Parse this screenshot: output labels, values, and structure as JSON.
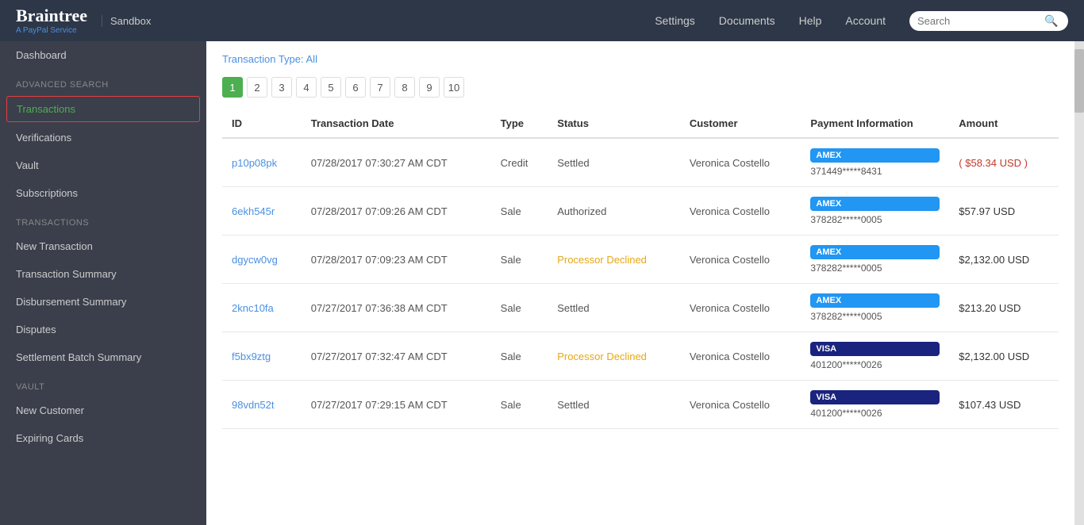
{
  "header": {
    "logo_text": "Braintree",
    "logo_sub": "A PayPal Service",
    "sandbox_label": "Sandbox",
    "nav": [
      {
        "label": "Settings",
        "id": "settings"
      },
      {
        "label": "Documents",
        "id": "documents"
      },
      {
        "label": "Help",
        "id": "help"
      },
      {
        "label": "Account",
        "id": "account"
      }
    ],
    "search_placeholder": "Search"
  },
  "sidebar": {
    "items": [
      {
        "label": "Dashboard",
        "id": "dashboard",
        "type": "item"
      },
      {
        "label": "Advanced Search",
        "id": "advanced-search",
        "type": "section-label"
      },
      {
        "label": "Transactions",
        "id": "transactions",
        "type": "item",
        "active": true
      },
      {
        "label": "Verifications",
        "id": "verifications",
        "type": "item"
      },
      {
        "label": "Vault",
        "id": "vault",
        "type": "item"
      },
      {
        "label": "Subscriptions",
        "id": "subscriptions",
        "type": "item"
      },
      {
        "label": "Transactions",
        "id": "transactions-section",
        "type": "section-label"
      },
      {
        "label": "New Transaction",
        "id": "new-transaction",
        "type": "item"
      },
      {
        "label": "Transaction Summary",
        "id": "transaction-summary",
        "type": "item"
      },
      {
        "label": "Disbursement Summary",
        "id": "disbursement-summary",
        "type": "item"
      },
      {
        "label": "Disputes",
        "id": "disputes",
        "type": "item"
      },
      {
        "label": "Settlement Batch Summary",
        "id": "settlement-batch-summary",
        "type": "item"
      },
      {
        "label": "Vault",
        "id": "vault-section",
        "type": "section-label"
      },
      {
        "label": "New Customer",
        "id": "new-customer",
        "type": "item"
      },
      {
        "label": "Expiring Cards",
        "id": "expiring-cards",
        "type": "item"
      }
    ]
  },
  "content": {
    "filter_label": "Transaction Type:",
    "filter_value": "All",
    "pagination": {
      "pages": [
        "1",
        "2",
        "3",
        "4",
        "5",
        "6",
        "7",
        "8",
        "9",
        "10"
      ],
      "active_page": "1"
    },
    "table": {
      "columns": [
        "ID",
        "Transaction Date",
        "Type",
        "Status",
        "Customer",
        "Payment Information",
        "Amount"
      ],
      "rows": [
        {
          "id": "p10p08pk",
          "date": "07/28/2017 07:30:27 AM CDT",
          "type": "Credit",
          "status": "Settled",
          "customer": "Veronica Costello",
          "card_type": "AMEX",
          "card_num": "371449*****8431",
          "amount": "( $58.34 USD )",
          "amount_class": "credit"
        },
        {
          "id": "6ekh545r",
          "date": "07/28/2017 07:09:26 AM CDT",
          "type": "Sale",
          "status": "Authorized",
          "customer": "Veronica Costello",
          "card_type": "AMEX",
          "card_num": "378282*****0005",
          "amount": "$57.97 USD",
          "amount_class": "normal"
        },
        {
          "id": "dgycw0vg",
          "date": "07/28/2017 07:09:23 AM CDT",
          "type": "Sale",
          "status": "Processor Declined",
          "customer": "Veronica Costello",
          "card_type": "AMEX",
          "card_num": "378282*****0005",
          "amount": "$2,132.00 USD",
          "amount_class": "normal"
        },
        {
          "id": "2knc10fa",
          "date": "07/27/2017 07:36:38 AM CDT",
          "type": "Sale",
          "status": "Settled",
          "customer": "Veronica Costello",
          "card_type": "AMEX",
          "card_num": "378282*****0005",
          "amount": "$213.20 USD",
          "amount_class": "normal"
        },
        {
          "id": "f5bx9ztg",
          "date": "07/27/2017 07:32:47 AM CDT",
          "type": "Sale",
          "status": "Processor Declined",
          "customer": "Veronica Costello",
          "card_type": "VISA",
          "card_num": "401200*****0026",
          "amount": "$2,132.00 USD",
          "amount_class": "normal"
        },
        {
          "id": "98vdn52t",
          "date": "07/27/2017 07:29:15 AM CDT",
          "type": "Sale",
          "status": "Settled",
          "customer": "Veronica Costello",
          "card_type": "VISA",
          "card_num": "401200*****0026",
          "amount": "$107.43 USD",
          "amount_class": "normal"
        }
      ]
    }
  }
}
